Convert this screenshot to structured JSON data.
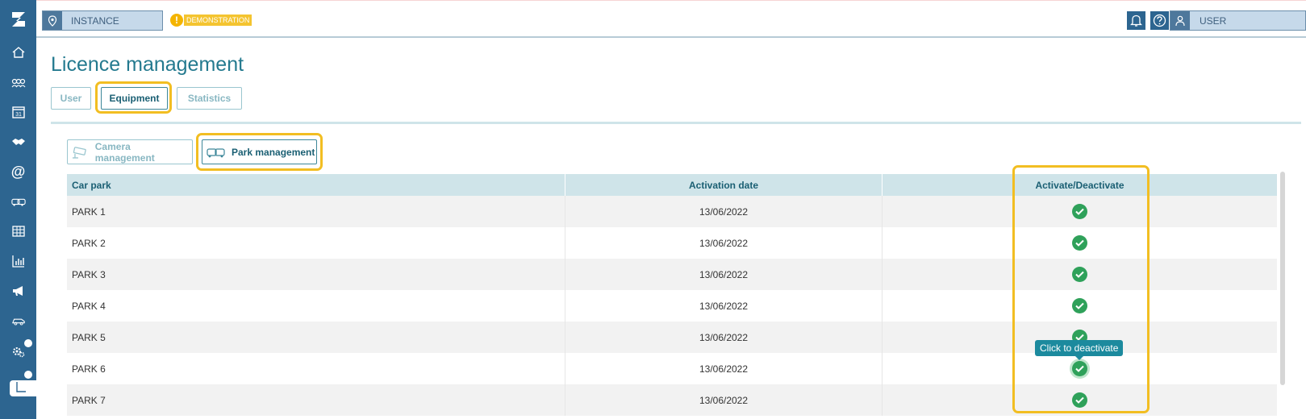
{
  "topbar": {
    "instance_label": "INSTANCE",
    "demo_label": "DEMONSTRATION",
    "user_label": "USER",
    "icons": [
      "location-pin-icon",
      "warning-icon",
      "bell-icon",
      "help-icon",
      "user-icon"
    ]
  },
  "sidebar": {
    "items": [
      "home-icon",
      "groups-icon",
      "calendar-icon",
      "handshake-icon",
      "at-icon",
      "vehicles-icon",
      "table-icon",
      "bar-chart-icon",
      "megaphone-icon",
      "car-icon",
      "settings-icon",
      "sub-item-icon"
    ],
    "calendar_number": "31",
    "at_symbol": "@"
  },
  "page": {
    "title": "Licence management",
    "tabs": [
      "User",
      "Equipment",
      "Statistics"
    ],
    "active_tab": "Equipment"
  },
  "subtabs": {
    "camera": "Camera management",
    "park": "Park management",
    "active": "Park management"
  },
  "table": {
    "columns": [
      "Car park",
      "Activation date",
      "Activate/Deactivate"
    ],
    "rows": [
      {
        "name": "PARK 1",
        "date": "13/06/2022",
        "active": true
      },
      {
        "name": "PARK 2",
        "date": "13/06/2022",
        "active": true
      },
      {
        "name": "PARK 3",
        "date": "13/06/2022",
        "active": true
      },
      {
        "name": "PARK 4",
        "date": "13/06/2022",
        "active": true
      },
      {
        "name": "PARK 5",
        "date": "13/06/2022",
        "active": true
      },
      {
        "name": "PARK 6",
        "date": "13/06/2022",
        "active": true
      },
      {
        "name": "PARK 7",
        "date": "13/06/2022",
        "active": true
      }
    ]
  },
  "tooltip": "Click to deactivate",
  "colors": {
    "sidebar": "#2d6590",
    "accent": "#247a8f",
    "highlight": "#f2be22",
    "check": "#2fa15a"
  }
}
